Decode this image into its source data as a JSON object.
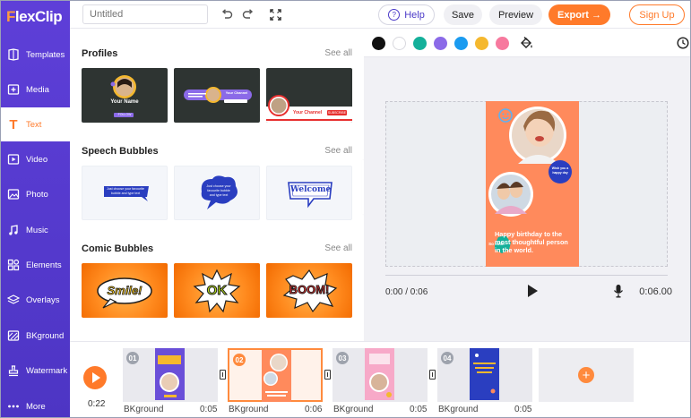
{
  "app": {
    "logo_text": "lexClip",
    "logo_initial": "F"
  },
  "sidebar": {
    "items": [
      {
        "label": "Templates",
        "icon": "templates-icon"
      },
      {
        "label": "Media",
        "icon": "media-icon"
      },
      {
        "label": "Text",
        "icon": "text-icon",
        "active": true
      },
      {
        "label": "Video",
        "icon": "video-icon"
      },
      {
        "label": "Photo",
        "icon": "photo-icon"
      },
      {
        "label": "Music",
        "icon": "music-icon"
      },
      {
        "label": "Elements",
        "icon": "elements-icon"
      },
      {
        "label": "Overlays",
        "icon": "overlays-icon"
      },
      {
        "label": "BKground",
        "icon": "background-icon"
      },
      {
        "label": "Watermark",
        "icon": "watermark-icon"
      },
      {
        "label": "More",
        "icon": "more-icon"
      }
    ]
  },
  "toolbar": {
    "title_placeholder": "Untitled",
    "help_label": "Help",
    "save_label": "Save",
    "preview_label": "Preview",
    "export_label": "Export",
    "export_arrow": "→",
    "signup_label": "Sign Up"
  },
  "library": {
    "sections": [
      {
        "title": "Profiles",
        "see_all": "See all"
      },
      {
        "title": "Speech Bubbles",
        "see_all": "See all"
      },
      {
        "title": "Comic Bubbles",
        "see_all": "See all"
      }
    ],
    "profiles": {
      "name": "Your Name",
      "channel": "Your Channel",
      "follow": "FOLLOW",
      "subscribe": "SUBSCRIBE"
    },
    "speech": {
      "bubble_text": "Just choose your favourite bubble and type text",
      "welcome": "Welcome"
    },
    "comic": {
      "smile": "Smile!",
      "ok": "OK",
      "boom": "BOOM!"
    }
  },
  "palette": {
    "colors": [
      "#111111",
      "#ffffff",
      "#14b09a",
      "#8b6ae8",
      "#1a9bf0",
      "#f5b82e",
      "#f7799e"
    ]
  },
  "canvas": {
    "card_text": "Happy birthday to the most thoughtful person in the world.",
    "badge_top": "Wish you a happy day",
    "badge_side": "So cool!",
    "time_current": "0:00 / 0:06",
    "time_total": "0:06.00",
    "progress": 0
  },
  "timeline": {
    "current_time": "0:22",
    "scenes": [
      {
        "num": "01",
        "label": "BKground",
        "duration": "0:05",
        "active": false
      },
      {
        "num": "02",
        "label": "BKground",
        "duration": "0:06",
        "active": true
      },
      {
        "num": "03",
        "label": "BKground",
        "duration": "0:05",
        "active": false
      },
      {
        "num": "04",
        "label": "BKground",
        "duration": "0:05",
        "active": false
      }
    ],
    "add_label": "+"
  }
}
